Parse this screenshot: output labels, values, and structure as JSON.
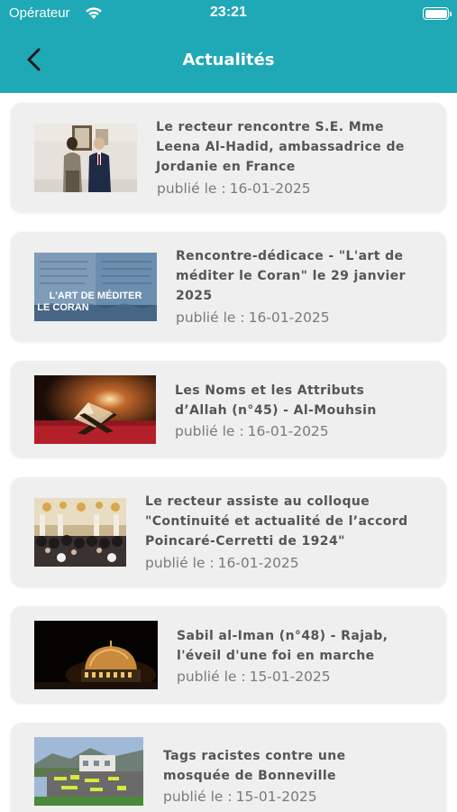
{
  "status_bar": {
    "carrier": "Opérateur",
    "time": "23:21",
    "wifi_icon": "wifi-icon",
    "battery_icon": "battery-icon"
  },
  "nav": {
    "title": "Actualités",
    "back_icon": "chevron-left-icon"
  },
  "colors": {
    "header": "#1fa8b6",
    "card_bg": "#efefef",
    "title_text": "#555555",
    "date_text": "#7a7a7a"
  },
  "articles": [
    {
      "title_lines": [
        "Le recteur rencontre S.E. Mme",
        "Leena Al-Hadid, ambassadrice de",
        "Jordanie en France"
      ],
      "date_label": "publié le :",
      "date": "16-01-2025"
    },
    {
      "title_lines": [
        "Rencontre-dédicace - \"L'art de",
        "méditer le Coran\" le 29 janvier",
        "2025"
      ],
      "date_label": "publié le :",
      "date": "16-01-2025",
      "image_caption_lines": [
        "L'ART DE MÉDITER",
        "LE CORAN"
      ]
    },
    {
      "title_lines": [
        "Les Noms et les Attributs",
        "d’Allah (n°45) - Al-Mouhsin"
      ],
      "date_label": "publié le :",
      "date": "16-01-2025"
    },
    {
      "title_lines": [
        "Le recteur assiste au colloque",
        "\"Continuité et actualité de l’accord",
        "Poincaré-Cerretti de 1924\""
      ],
      "date_label": "publié le :",
      "date": "16-01-2025"
    },
    {
      "title_lines": [
        "Sabil al-Iman (n°48) - Rajab,",
        "l'éveil d'une foi en marche"
      ],
      "date_label": "publié le :",
      "date": "15-01-2025"
    },
    {
      "title_lines": [
        "Tags racistes contre une",
        "mosquée de Bonneville"
      ],
      "date_label": "publié le :",
      "date": "15-01-2025"
    }
  ]
}
